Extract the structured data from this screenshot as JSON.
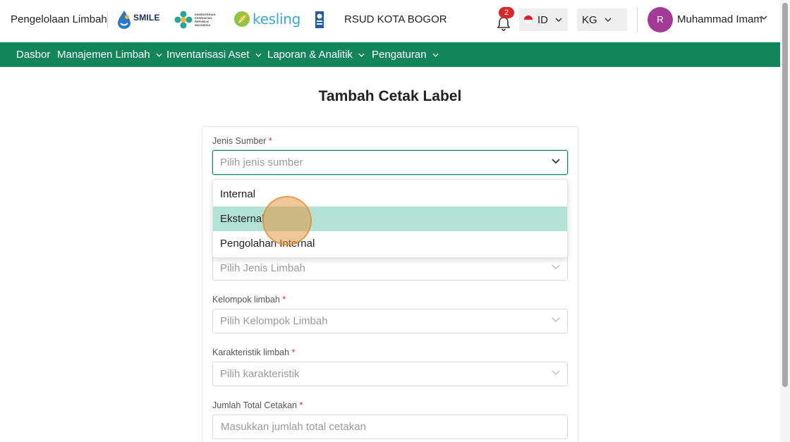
{
  "header": {
    "app_title": "Pengelolaan Limbah",
    "logos": {
      "smile": "SMILE",
      "kemenkes_lines": [
        "KEMENTERIAN",
        "KESEHATAN",
        "REPUBLIK",
        "INDONESIA"
      ],
      "kesling": "kesling"
    },
    "hospital_name": "RSUD KOTA BOGOR",
    "notification_count": "2",
    "language": "ID",
    "unit": "KG",
    "user_initial": "R",
    "user_name": "Muhammad Imam"
  },
  "nav": {
    "items": [
      {
        "label": "Dasbor",
        "has_dropdown": false
      },
      {
        "label": "Manajemen Limbah",
        "has_dropdown": true
      },
      {
        "label": "Inventarisasi Aset",
        "has_dropdown": true
      },
      {
        "label": "Laporan & Analitik",
        "has_dropdown": true
      },
      {
        "label": "Pengaturan",
        "has_dropdown": true
      }
    ]
  },
  "page": {
    "title": "Tambah Cetak Label"
  },
  "form": {
    "source_type": {
      "label": "Jenis Sumber",
      "required_mark": "*",
      "placeholder": "Pilih jenis sumber",
      "options": [
        "Internal",
        "Eksternal",
        "Pengolahan Internal"
      ],
      "highlighted_option": "Eksternal"
    },
    "waste_type": {
      "placeholder": "Pilih Jenis Limbah"
    },
    "waste_group": {
      "label": "Kelompok limbah",
      "required_mark": "*",
      "placeholder": "Pilih Kelompok Limbah"
    },
    "characteristic": {
      "label": "Karakteristik limbah",
      "required_mark": "*",
      "placeholder": "Pilih karakteristik"
    },
    "total_prints": {
      "label": "Jumlah Total Cetakan",
      "required_mark": "*",
      "placeholder": "Masukkan jumlah total cetakan"
    }
  },
  "colors": {
    "primary_green": "#12855a",
    "highlight_option": "#b1e2d3",
    "badge_red": "#d62828",
    "avatar_purple": "#a33a96"
  }
}
